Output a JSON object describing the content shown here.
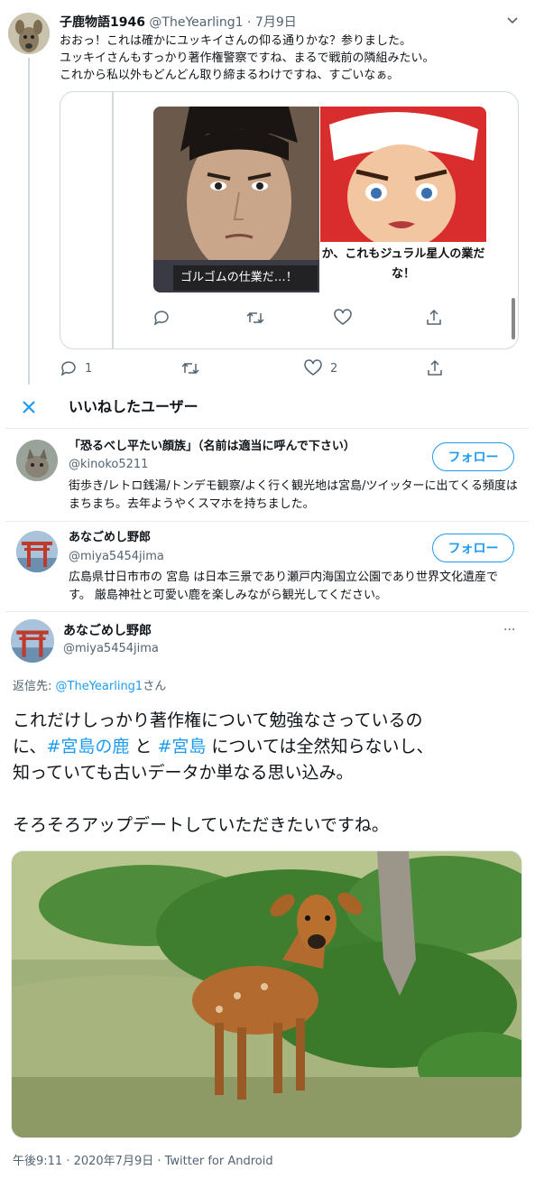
{
  "top_tweet": {
    "name": "子鹿物語1946",
    "handle": "@TheYearling1",
    "date": "7月9日",
    "dot": "·",
    "text": "おおっ！これは確かにユッキイさんの仰る通りかな？参りました。\nユッキイさんもすっかり著作権警察ですね、まるで戦前の隣組みたい。\nこれから私以外もどんどん取り締まるわけですね、すごいなぁ。",
    "quoted": {
      "left_caption": "ゴルゴムの仕業だ…！",
      "right_caption": "か、これもジュラル星人の業だな！"
    },
    "reply_count": "1",
    "like_count": "2"
  },
  "likes_panel": {
    "title": "いいねしたユーザー",
    "users": [
      {
        "name": "「恐るべし平たい顔族」（名前は適当に呼んで下さい）",
        "handle": "@kinoko5211",
        "bio": "街歩き/レトロ銭湯/トンデモ観察/よく行く観光地は宮島/ツイッターに出てくる頻度はまちまち。去年ようやくスマホを持ちました。",
        "follow_label": "フォロー"
      },
      {
        "name": "あなごめし野郎",
        "handle": "@miya5454jima",
        "bio": "広島県廿日市市の 宮島 は日本三景であり瀬戸内海国立公園であり世界文化遺産です。 厳島神社と可愛い鹿を楽しみながら観光してください。",
        "follow_label": "フォロー"
      }
    ]
  },
  "main_tweet": {
    "name": "あなごめし野郎",
    "handle": "@miya5454jima",
    "more": "···",
    "reply_to_prefix": "返信先: ",
    "reply_to_handle": "@TheYearling1",
    "reply_to_suffix": "さん",
    "text_line1": "これだけしっかり著作権について勉強なさっているの",
    "text_line2_pre": "に、",
    "hashtag1": "#宮島の鹿",
    "text_line2_mid": " と ",
    "hashtag2": "#宮島",
    "text_line2_post": " については全然知らないし、",
    "text_line3": "知っていても古いデータか単なる思い込み。",
    "text_line4": "そろそろアップデートしていただきたいですね。",
    "timestamp": "午後9:11 · 2020年7月9日 · Twitter for Android"
  },
  "colors": {
    "accent": "#1d9bf0",
    "text": "#0f1419",
    "muted": "#536471",
    "border": "#e6ecf0"
  }
}
